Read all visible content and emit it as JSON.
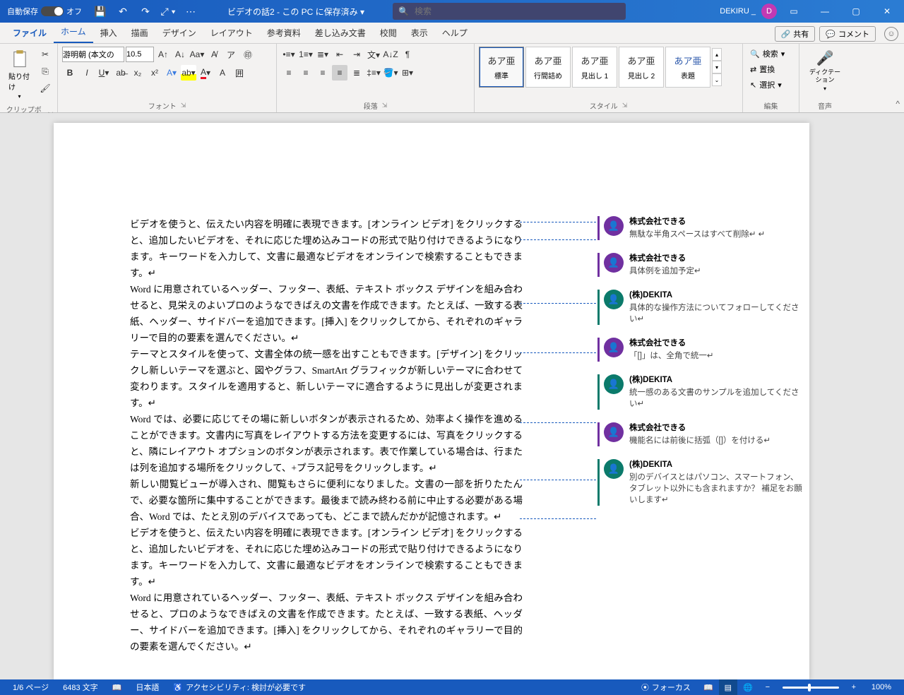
{
  "titlebar": {
    "autosave_label": "自動保存",
    "autosave_state": "オフ",
    "doc_title": "ビデオの話2 - この PC に保存済み ▾",
    "search_placeholder": "検索",
    "user_name": "DEKIRU _",
    "user_initial": "D"
  },
  "tabs": {
    "file": "ファイル",
    "home": "ホーム",
    "insert": "挿入",
    "draw": "描画",
    "design": "デザイン",
    "layout": "レイアウト",
    "references": "参考資料",
    "mailings": "差し込み文書",
    "review": "校閲",
    "view": "表示",
    "help": "ヘルプ",
    "share": "共有",
    "comments": "コメント"
  },
  "ribbon": {
    "clipboard": {
      "label": "クリップボード",
      "paste": "貼り付け"
    },
    "font": {
      "label": "フォント",
      "name": "游明朝 (本文の",
      "size": "10.5"
    },
    "paragraph": {
      "label": "段落"
    },
    "styles": {
      "label": "スタイル",
      "items": [
        "標準",
        "行間詰め",
        "見出し 1",
        "見出し 2",
        "表題"
      ],
      "preview": "あア亜"
    },
    "editing": {
      "label": "編集",
      "find": "検索",
      "replace": "置換",
      "select": "選択"
    },
    "dictation": {
      "label": "音声",
      "dictate": "ディクテーション"
    }
  },
  "document": {
    "paragraphs": [
      "ビデオを使うと、伝えたい内容を明確に表現できます。[オンライン ビデオ] をクリックすると、追加したいビデオを、それに応じた埋め込みコードの形式で貼り付けできるようになります。キーワードを入力して、文書に最適なビデオをオンラインで検索することもできます。↵",
      "Word に用意されているヘッダー、フッター、表紙、テキスト ボックス デザインを組み合わせると、見栄えのよいプロのようなできばえの文書を作成できます。たとえば、一致する表紙、ヘッダー、サイドバーを追加できます。[挿入] をクリックしてから、それぞれのギャラリーで目的の要素を選んでください。↵",
      "テーマとスタイルを使って、文書全体の統一感を出すこともできます。[デザイン] をクリックし新しいテーマを選ぶと、図やグラフ、SmartArt グラフィックが新しいテーマに合わせて変わります。スタイルを適用すると、新しいテーマに適合するように見出しが変更されます。↵",
      "Word では、必要に応じてその場に新しいボタンが表示されるため、効率よく操作を進めることができます。文書内に写真をレイアウトする方法を変更するには、写真をクリックすると、隣にレイアウト オプションのボタンが表示されます。表で作業している場合は、行または列を追加する場所をクリックして、+プラス記号をクリックします。↵",
      "新しい閲覧ビューが導入され、閲覧もさらに便利になりました。文書の一部を折りたたんで、必要な箇所に集中することができます。最後まで読み終わる前に中止する必要がある場合、Word では、たとえ別のデバイスであっても、どこまで読んだかが記憶されます。↵",
      "ビデオを使うと、伝えたい内容を明確に表現できます。[オンライン ビデオ] をクリックすると、追加したいビデオを、それに応じた埋め込みコードの形式で貼り付けできるようになります。キーワードを入力して、文書に最適なビデオをオンラインで検索することもできます。↵",
      "Word に用意されているヘッダー、フッター、表紙、テキスト ボックス デザインを組み合わせると、プロのようなできばえの文書を作成できます。たとえば、一致する表紙、ヘッダー、サイドバーを追加できます。[挿入] をクリックしてから、それぞれのギャラリーで目的の要素を選んでください。↵"
    ]
  },
  "comments_list": [
    {
      "color": "purple",
      "author": "株式会社できる",
      "text": "無駄な半角スペースはすべて削除↵\n↵"
    },
    {
      "color": "purple",
      "author": "株式会社できる",
      "text": "具体例を追加予定↵"
    },
    {
      "color": "teal",
      "author": "(株)DEKITA",
      "text": "具体的な操作方法についてフォローしてください↵"
    },
    {
      "color": "purple",
      "author": "株式会社できる",
      "text": "「[]」は、全角で統一↵"
    },
    {
      "color": "teal",
      "author": "(株)DEKITA",
      "text": "統一感のある文書のサンプルを追加してください↵"
    },
    {
      "color": "purple",
      "author": "株式会社できる",
      "text": "機能名には前後に括弧（[]）を付ける↵"
    },
    {
      "color": "teal",
      "author": "(株)DEKITA",
      "text": "別のデバイスとはパソコン、スマートフォン、タブレット以外にも含まれますか？ 補足をお願いします↵"
    }
  ],
  "statusbar": {
    "page": "1/6 ページ",
    "words": "6483 文字",
    "language": "日本語",
    "accessibility": "アクセシビリティ: 検討が必要です",
    "focus": "フォーカス",
    "zoom": "100%"
  }
}
